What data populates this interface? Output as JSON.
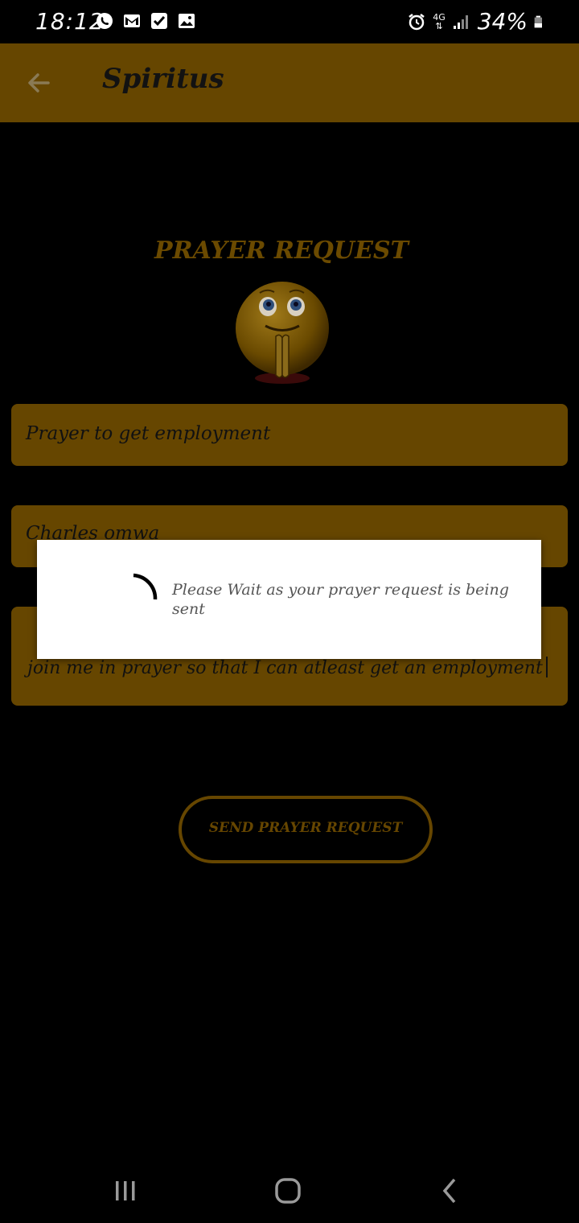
{
  "status_bar": {
    "time": "18:12",
    "network": "4G",
    "battery": "34%"
  },
  "app_bar": {
    "title": "Spiritus"
  },
  "headline": "PRAYER REQUEST",
  "form": {
    "title_value": "Prayer to get employment",
    "name_value": "Charles omwa",
    "message_value": "join me in prayer so that I can atleast get an employment"
  },
  "send_button": {
    "label": "SEND PRAYER REQUEST"
  },
  "dialog": {
    "message": "Please Wait as your prayer request is being sent"
  },
  "colors": {
    "app_bar": "#664600",
    "accent": "#664600",
    "background": "#000000",
    "dialog": "#ffffff"
  }
}
